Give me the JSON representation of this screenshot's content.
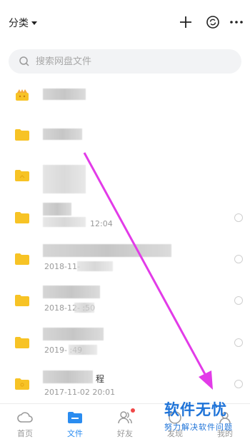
{
  "header": {
    "category_label": "分类"
  },
  "search": {
    "placeholder": "搜索网盘文件"
  },
  "files": [
    {
      "name_visible": "",
      "date_visible": ""
    },
    {
      "name_visible": "",
      "date_visible": ""
    },
    {
      "name_visible": "",
      "date_visible": ""
    },
    {
      "name_visible": "",
      "date_visible": "12:04"
    },
    {
      "name_visible": "",
      "date_visible": "2018-11-"
    },
    {
      "name_visible": "",
      "date_visible": "2018-12-  :50"
    },
    {
      "name_visible": "",
      "date_visible": "2019-    :49"
    },
    {
      "name_visible": "程",
      "date_visible": "2017-11-02  20:01"
    }
  ],
  "tabs": [
    {
      "label": "首页",
      "active": false
    },
    {
      "label": "文件",
      "active": true
    },
    {
      "label": "好友",
      "active": false
    },
    {
      "label": "发现",
      "active": false
    },
    {
      "label": "我的",
      "active": false
    }
  ],
  "watermark": {
    "title": "软件无忧",
    "subtitle": "努力解决软件问题"
  },
  "colors": {
    "accent": "#2a8cf0",
    "folder": "#f7c325",
    "annotation": "#e23be8"
  }
}
